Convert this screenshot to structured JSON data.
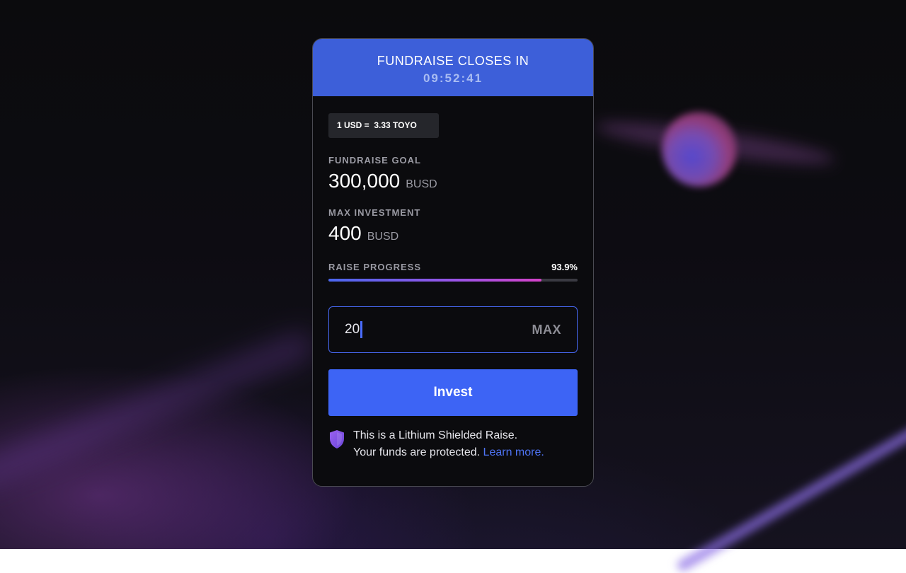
{
  "header": {
    "title": "FUNDRAISE CLOSES IN",
    "timer": "09:52:41"
  },
  "rate": {
    "label": "1 USD =  3.33 TOYO"
  },
  "goal": {
    "label": "FUNDRAISE GOAL",
    "value": "300,000",
    "unit": "BUSD"
  },
  "max_investment": {
    "label": "MAX INVESTMENT",
    "value": "400",
    "unit": "BUSD"
  },
  "progress": {
    "label": "RAISE PROGRESS",
    "percent_text": "93.9%",
    "fraction": 0.856
  },
  "amount_input": {
    "value": "20",
    "max_label": "MAX"
  },
  "invest_button": {
    "label": "Invest"
  },
  "shield_notice": {
    "line1": "This is a Lithium Shielded Raise.",
    "line2": "Your funds are protected.",
    "link": "Learn more."
  },
  "colors": {
    "header_bg": "#3d5fd9",
    "accent": "#3d64f5",
    "link": "#4e74f5",
    "shield": "#8a58e8"
  },
  "icons": {
    "shield": "shield-icon"
  }
}
